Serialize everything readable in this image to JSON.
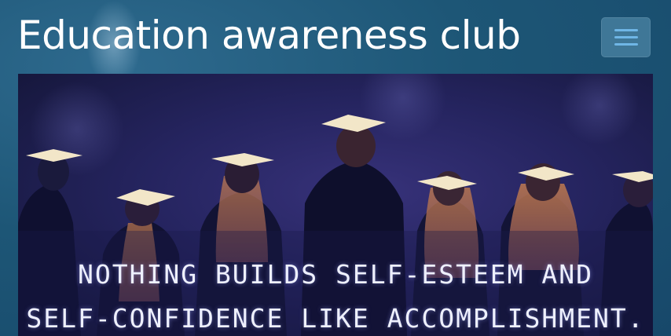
{
  "header": {
    "title": "Education awareness club",
    "menu_icon": "hamburger-menu-icon"
  },
  "hero": {
    "image_subject": "graduates-in-caps",
    "quote_line_1": "NOTHING BUILDS SELF-ESTEEM AND",
    "quote_line_2": "SELF-CONFIDENCE LIKE ACCOMPLISHMENT."
  },
  "colors": {
    "page_background": "#1d5676",
    "menu_button": "#3f7797",
    "menu_bars": "#6fb6e6",
    "hero_background": "#25245f",
    "cap_color": "#f2e6c8"
  }
}
